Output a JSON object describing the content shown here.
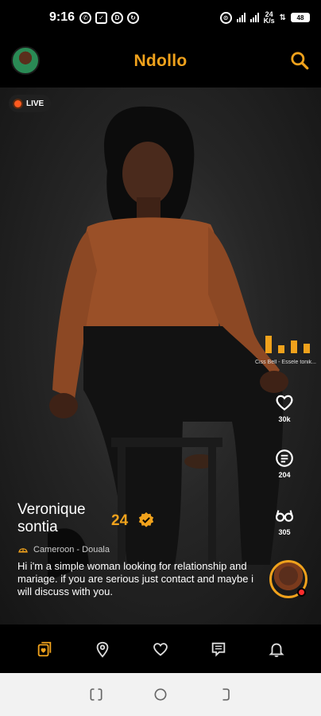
{
  "status_bar": {
    "time": "9:16",
    "net_speed": "24",
    "net_unit": "K/s",
    "battery_level": "48"
  },
  "header": {
    "title": "Ndollo"
  },
  "live": {
    "label": "LIVE"
  },
  "music": {
    "track": "Ciss Bell - Essele tonik..."
  },
  "actions": {
    "likes": "30k",
    "comments": "204",
    "views": "305"
  },
  "profile": {
    "name": "Veronique sontia",
    "age": "24",
    "location": "Cameroon - Douala",
    "bio": "Hi i'm a simple woman looking for relationship and mariage. if you are serious just contact and maybe i will discuss with you."
  },
  "colors": {
    "accent": "#f0a21c",
    "background": "#000000",
    "live_dot": "#ff5a1f",
    "online_dot": "#ff2d2d"
  },
  "icons": {
    "nav": [
      "feed-icon",
      "location-pin-icon",
      "heart-icon",
      "chat-icon",
      "bell-icon"
    ],
    "system": [
      "recent-apps-icon",
      "home-icon",
      "back-icon"
    ]
  }
}
